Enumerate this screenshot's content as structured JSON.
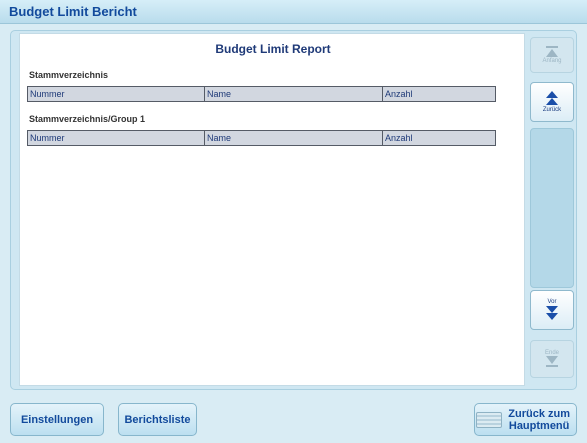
{
  "window": {
    "title": "Budget Limit Bericht"
  },
  "report": {
    "title": "Budget Limit Report",
    "sections": [
      {
        "label": "Stammverzeichnis",
        "columns": [
          "Nummer",
          "Name",
          "Anzahl"
        ]
      },
      {
        "label": "Stammverzeichnis/Group 1",
        "columns": [
          "Nummer",
          "Name",
          "Anzahl"
        ]
      }
    ]
  },
  "scroll": {
    "first_label": "Anfang",
    "back_label": "Zurück",
    "forward_label": "Vor",
    "last_label": "Ende"
  },
  "buttons": {
    "settings": "Einstellungen",
    "report_list": "Berichtsliste",
    "home_line1": "Zurück zum",
    "home_line2": "Hauptmenü"
  }
}
